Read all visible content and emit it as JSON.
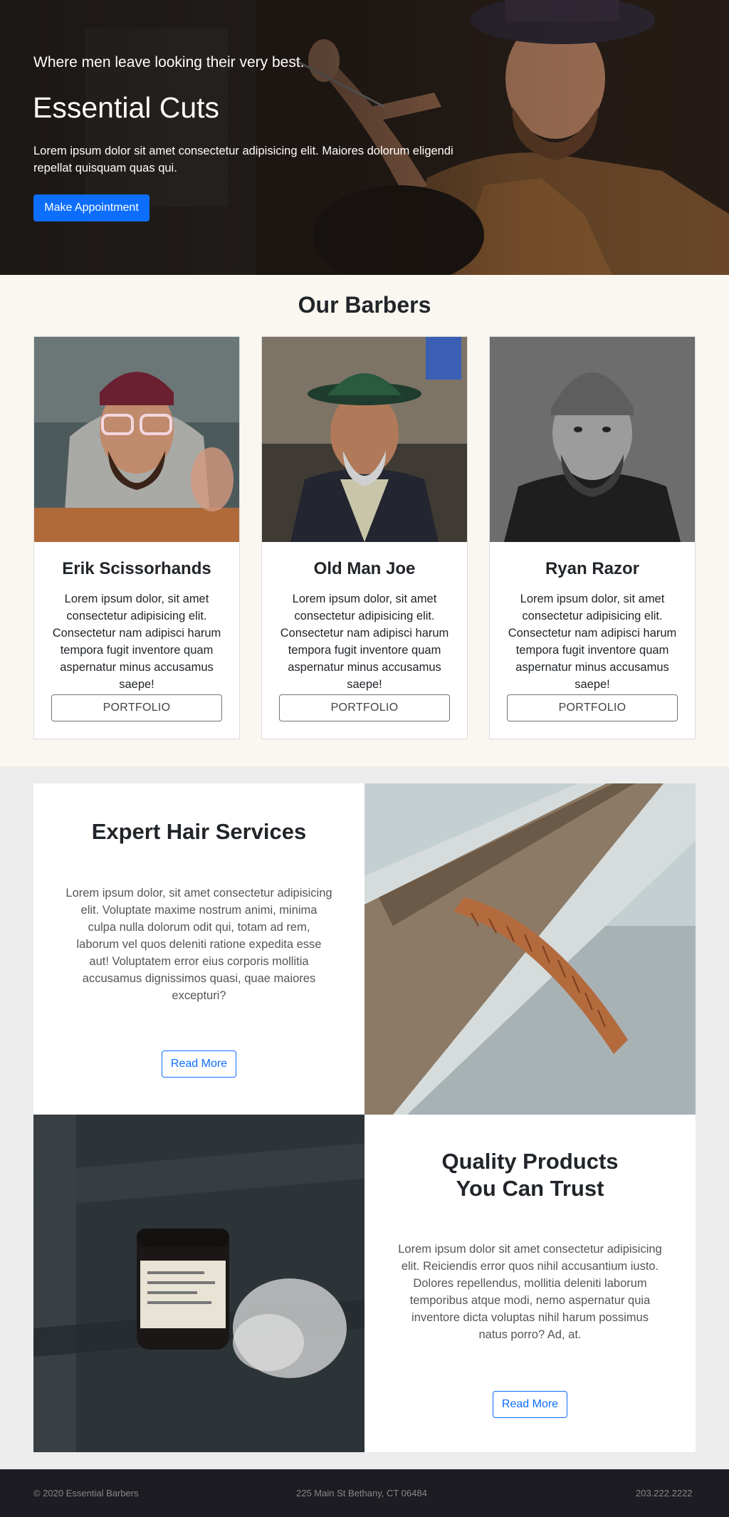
{
  "hero": {
    "tagline": "Where men leave looking their very best.",
    "title": "Essential Cuts",
    "description": "Lorem ipsum dolor sit amet consectetur adipisicing elit. Maiores dolorum eligendi repellat quisquam quas qui.",
    "button_label": "Make Appointment"
  },
  "barbers": {
    "title": "Our Barbers",
    "items": [
      {
        "name": "Erik Scissorhands",
        "bio": "Lorem ipsum dolor, sit amet consectetur adipisicing elit. Consectetur nam adipisci harum tempora fugit inventore quam aspernatur minus accusamus saepe!",
        "button_label": "PORTFOLIO"
      },
      {
        "name": "Old Man Joe",
        "bio": "Lorem ipsum dolor, sit amet consectetur adipisicing elit. Consectetur nam adipisci harum tempora fugit inventore quam aspernatur minus accusamus saepe!",
        "button_label": "PORTFOLIO"
      },
      {
        "name": "Ryan Razor",
        "bio": "Lorem ipsum dolor, sit amet consectetur adipisicing elit. Consectetur nam adipisci harum tempora fugit inventore quam aspernatur minus accusamus saepe!",
        "button_label": "PORTFOLIO"
      }
    ]
  },
  "services": {
    "title": "Expert Hair Services",
    "text": "Lorem ipsum dolor, sit amet consectetur adipisicing elit. Voluptate maxime nostrum animi, minima culpa nulla dolorum odit qui, totam ad rem, laborum vel quos deleniti ratione expedita esse aut! Voluptatem error eius corporis mollitia accusamus dignissimos quasi, quae maiores excepturi?",
    "button_label": "Read More"
  },
  "products": {
    "title_line1": "Quality Products",
    "title_line2": "You Can Trust",
    "text": "Lorem ipsum dolor sit amet consectetur adipisicing elit. Reiciendis error quos nihil accusantium iusto. Dolores repellendus, mollitia deleniti laborum temporibus atque modi, nemo aspernatur quia inventore dicta voluptas nihil harum possimus natus porro? Ad, at.",
    "button_label": "Read More"
  },
  "footer": {
    "copyright": "© 2020 Essential Barbers",
    "address": "225 Main St Bethany, CT 06484",
    "phone": "203.222.2222"
  },
  "colors": {
    "primary": "#0d6efd",
    "barbers_bg": "#f9f7f0",
    "page_bg": "#ececec",
    "footer_bg": "#1c1c22"
  }
}
